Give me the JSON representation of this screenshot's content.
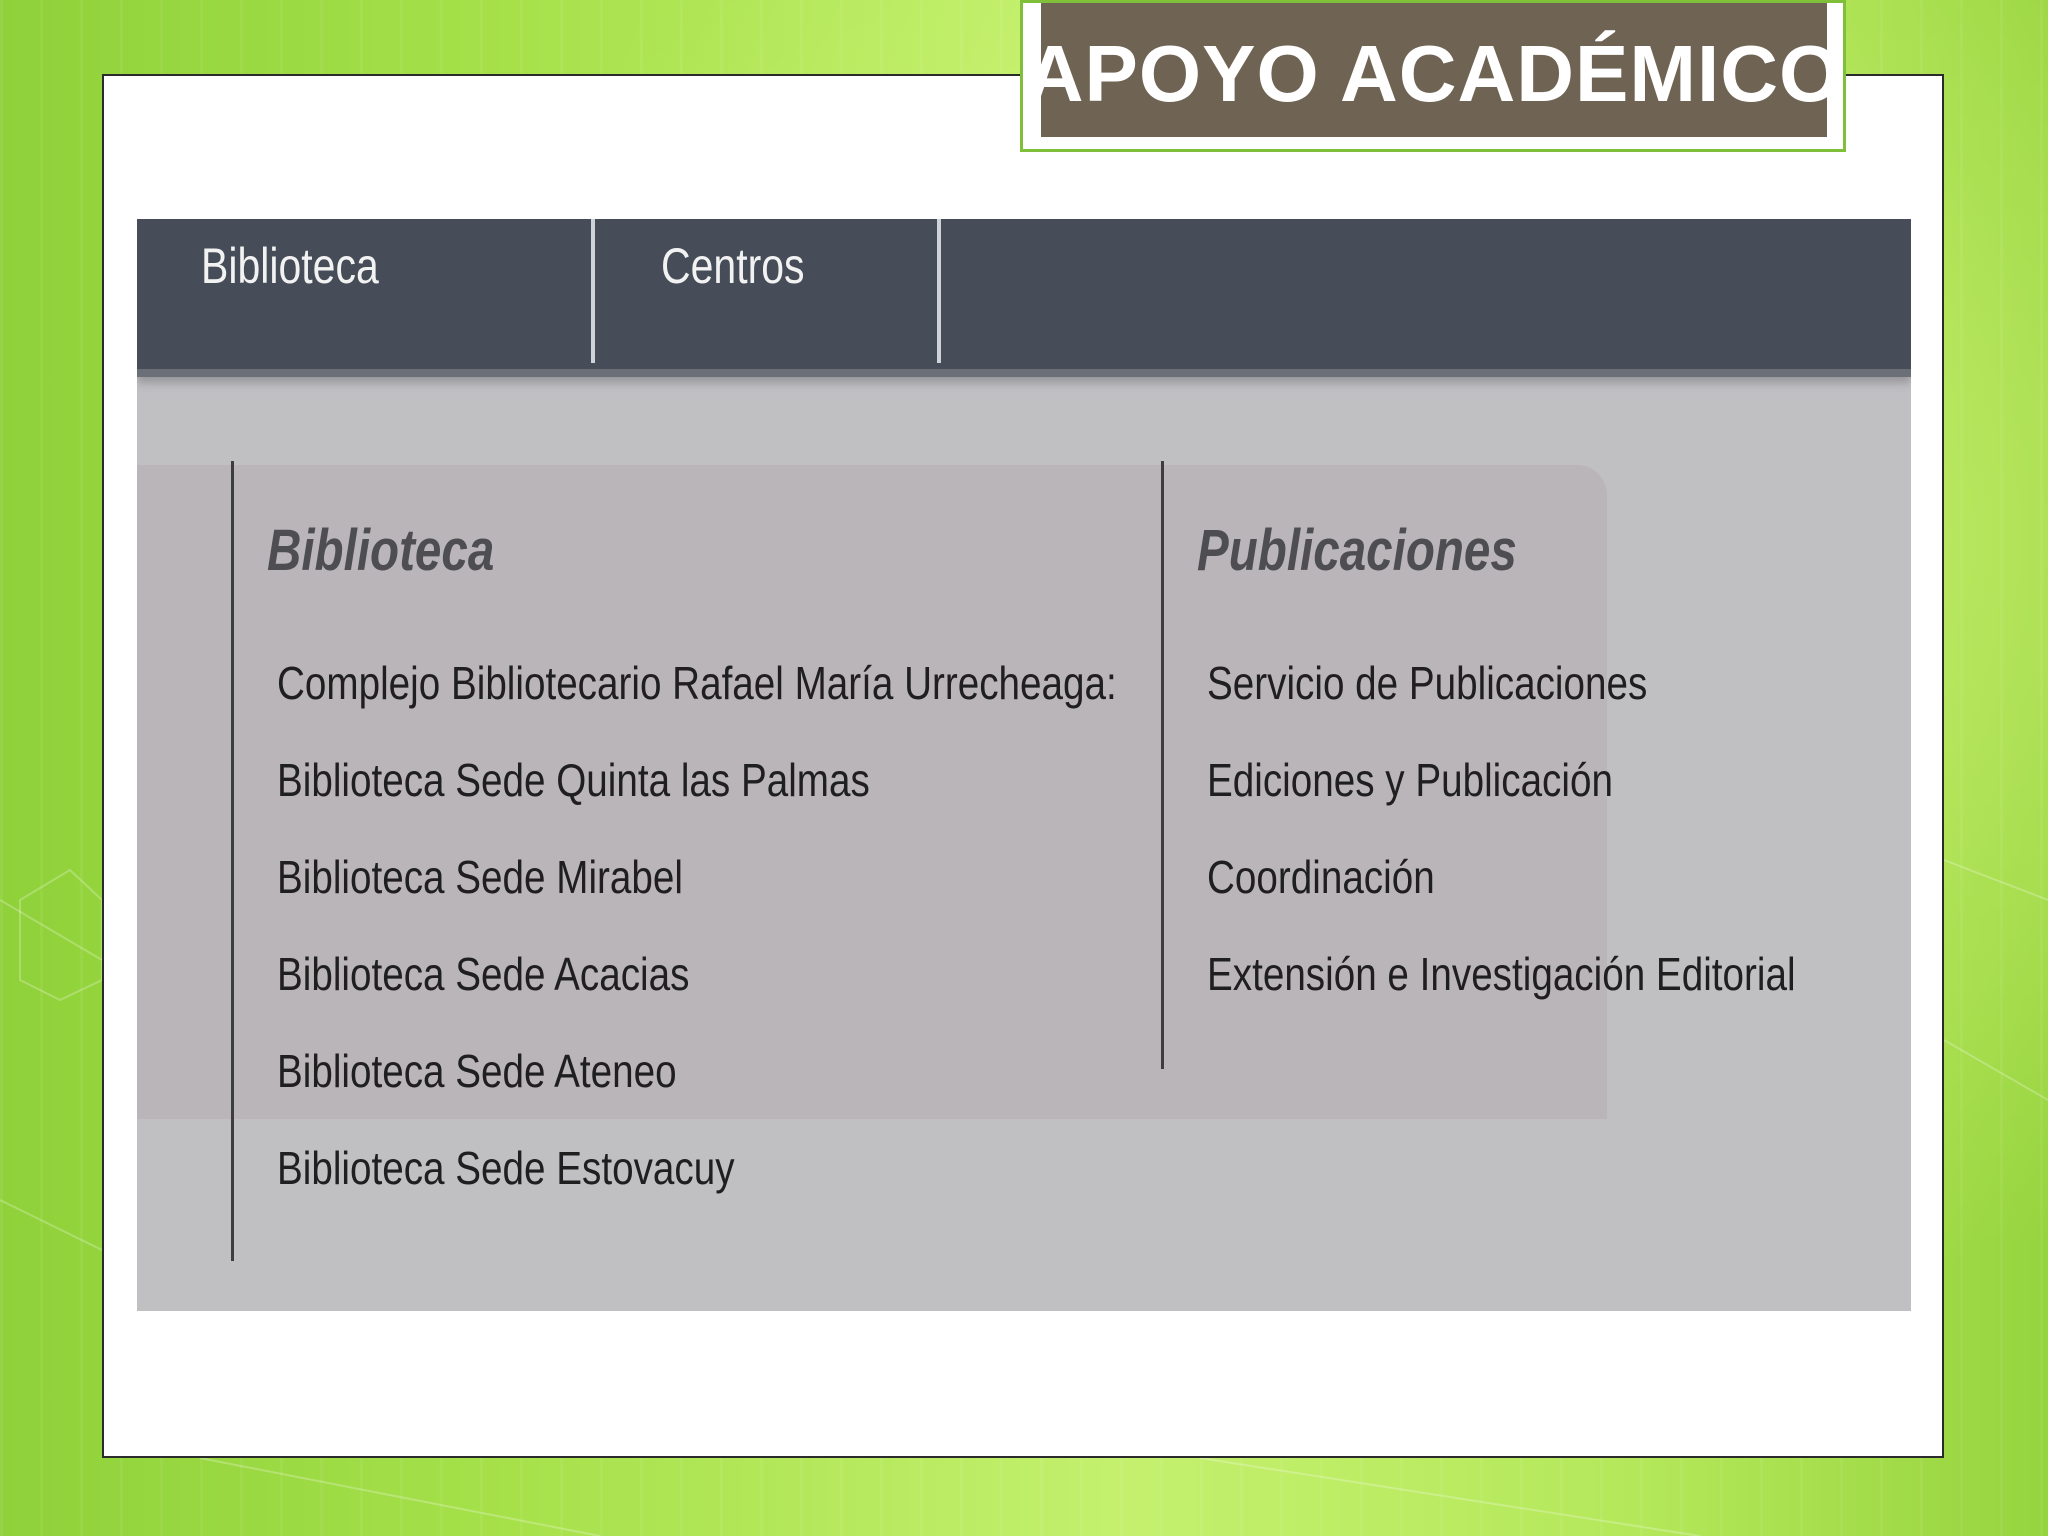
{
  "slide": {
    "title": "APOYO ACADÉMICO"
  },
  "navbar": {
    "tabs": [
      {
        "label": "Biblioteca"
      },
      {
        "label": "Centros"
      }
    ]
  },
  "menu": {
    "columns": [
      {
        "heading": "Biblioteca",
        "items": [
          "Complejo Bibliotecario Rafael María Urrecheaga:",
          "Biblioteca Sede Quinta las Palmas",
          "Biblioteca Sede Mirabel",
          "Biblioteca Sede Acacias",
          "Biblioteca Sede Ateneo",
          "Biblioteca Sede Estovacuy"
        ]
      },
      {
        "heading": "Publicaciones",
        "items": [
          "Servicio de Publicaciones",
          "Ediciones y Publicación",
          "Coordinación",
          "Extensión e Investigación Editorial"
        ]
      }
    ]
  },
  "colors": {
    "navbar": "#464c58",
    "title_box": "#6f6454",
    "background_green": "#b4e85a"
  }
}
